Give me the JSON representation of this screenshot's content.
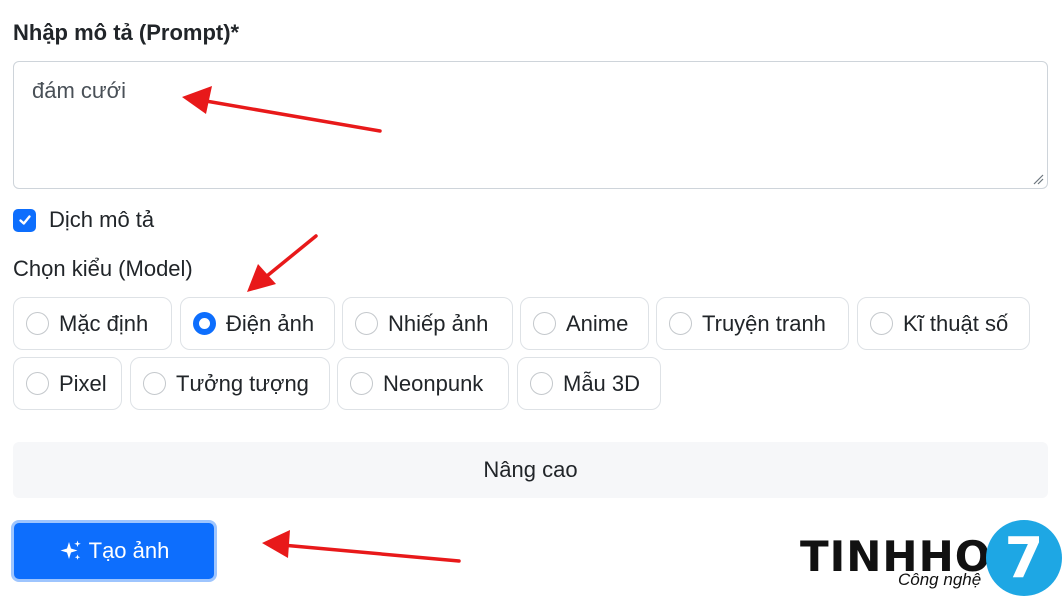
{
  "prompt": {
    "label": "Nhập mô tả (Prompt)*",
    "value": "đám cưới"
  },
  "translate": {
    "label": "Dịch mô tả",
    "checked": true
  },
  "model": {
    "label": "Chọn kiểu (Model)",
    "selected": "Điện ảnh",
    "options": [
      "Mặc định",
      "Điện ảnh",
      "Nhiếp ảnh",
      "Anime",
      "Truyện tranh",
      "Kĩ thuật số",
      "Pixel",
      "Tưởng tượng",
      "Neonpunk",
      "Mẫu 3D"
    ]
  },
  "advanced": {
    "label": "Nâng cao"
  },
  "generate": {
    "label": "Tạo ảnh",
    "icon": "sparkles-icon"
  },
  "watermark": {
    "brand": "TINHHOA",
    "tagline": "Công nghệ",
    "badge": "7"
  },
  "colors": {
    "primary": "#0d6efd",
    "annotation_arrow": "#e8191a",
    "logo_badge": "#1ea7e4"
  }
}
